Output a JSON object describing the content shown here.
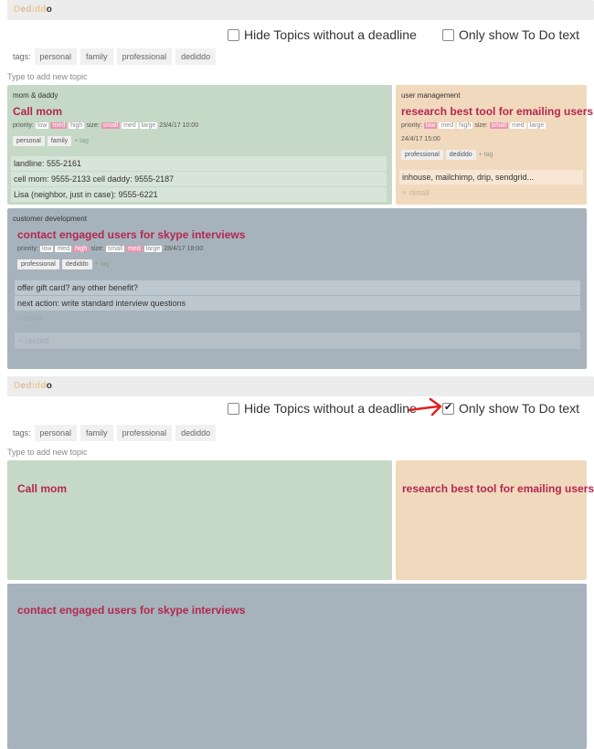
{
  "app": {
    "logo_letters": [
      "D",
      "e",
      "d",
      "i",
      "d",
      "d",
      "o"
    ]
  },
  "filters": {
    "hide_without_deadline": "Hide Topics without a deadline",
    "only_todo": "Only show To Do text"
  },
  "tags_bar": {
    "label": "tags:",
    "tags": [
      "personal",
      "family",
      "professional",
      "dediddo"
    ]
  },
  "new_topic_placeholder": "Type to add new topic",
  "top_panel": {
    "cards": {
      "mom": {
        "category": "mom & daddy",
        "title": "Call mom",
        "priority_label": "priority:",
        "priorities": [
          "low",
          "med",
          "high"
        ],
        "priority_selected": "med",
        "size_label": "size:",
        "sizes": [
          "small",
          "med",
          "large"
        ],
        "size_selected": "small",
        "deadline": "23/4/17 10:00",
        "tags": [
          "personal",
          "family"
        ],
        "add_tag": "+ tag",
        "details": [
          "landline: 555-2161",
          "cell mom: 9555-2133 cell daddy: 9555-2187",
          "Lisa (neighbor, just in case): 9555-6221"
        ]
      },
      "users": {
        "category": "user management",
        "title": "research best tool for emailing users",
        "priority_label": "priority:",
        "priorities": [
          "low",
          "med",
          "high"
        ],
        "priority_selected": "low",
        "size_label": "size:",
        "sizes": [
          "small",
          "med",
          "large"
        ],
        "size_selected": "small",
        "deadline": "24/4/17 15:00",
        "tags": [
          "professional",
          "dediddo"
        ],
        "add_tag": "+ tag",
        "details": [
          "inhouse, mailchimp, drip, sendgrid..."
        ],
        "add_detail": "+ detail"
      },
      "customer": {
        "category": "customer development",
        "title": "contact engaged users for skype interviews",
        "priority_label": "priority:",
        "priorities": [
          "low",
          "med",
          "high"
        ],
        "priority_selected": "high",
        "size_label": "size:",
        "sizes": [
          "small",
          "med",
          "large"
        ],
        "size_selected": "med",
        "deadline": "28/4/17 18:00",
        "tags": [
          "professional",
          "dediddo"
        ],
        "add_tag": "+ tag",
        "details": [
          "offer gift card? any other benefit?",
          "next action: write standard interview questions"
        ],
        "add_detail": "+ detail",
        "add_record": "+ record"
      }
    }
  },
  "bottom_panel": {
    "titles": {
      "mom": "Call mom",
      "users": "research best tool for emailing users",
      "customer": "contact engaged users for skype interviews"
    }
  },
  "colors": {
    "green": "#c5d9c6",
    "orange": "#f1d9be",
    "slate": "#a7b3bc",
    "title": "#b3284f",
    "arrow": "#e02020"
  }
}
